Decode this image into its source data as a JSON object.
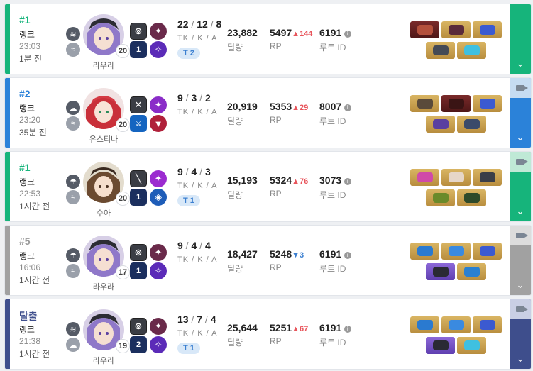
{
  "labels": {
    "kda": "TK / K / A",
    "damage": "딜량",
    "rp": "RP",
    "route": "루트 ID",
    "rank": "랭크"
  },
  "colors": {
    "win": "#16b47b",
    "second": "#2b82d9",
    "grey": "#a1a1a1",
    "escape": "#3e4e8c",
    "rp_up": "#e8555c",
    "rp_down": "#3b7fd0"
  },
  "games": [
    {
      "rank": "#1",
      "rank_label": "랭크",
      "time": "23:03",
      "ago": "1분 전",
      "character": "라우라",
      "level": "20",
      "tk": "22",
      "k": "12",
      "a": "8",
      "team": "T 2",
      "damage": "23,882",
      "rp": "5497",
      "rp_change": "▲144",
      "rp_dir": "up",
      "route": "6191",
      "weather": [
        "wind-icon",
        "fog-icon"
      ],
      "has_video": false
    },
    {
      "rank": "#2",
      "rank_label": "랭크",
      "time": "23:20",
      "ago": "35분 전",
      "character": "유스티나",
      "level": "20",
      "tk": "9",
      "k": "3",
      "a": "2",
      "team": "",
      "damage": "20,919",
      "rp": "5353",
      "rp_change": "▲29",
      "rp_dir": "up",
      "route": "8007",
      "weather": [
        "cloud-icon",
        "fog-icon"
      ],
      "has_video": true
    },
    {
      "rank": "#1",
      "rank_label": "랭크",
      "time": "22:53",
      "ago": "1시간 전",
      "character": "수아",
      "level": "20",
      "tk": "9",
      "k": "4",
      "a": "3",
      "team": "T 1",
      "damage": "15,193",
      "rp": "5324",
      "rp_change": "▲76",
      "rp_dir": "up",
      "route": "3073",
      "weather": [
        "rain-icon",
        "fog-icon"
      ],
      "has_video": true
    },
    {
      "rank": "#5",
      "rank_label": "랭크",
      "time": "16:06",
      "ago": "1시간 전",
      "character": "라우라",
      "level": "17",
      "tk": "9",
      "k": "4",
      "a": "4",
      "team": "",
      "damage": "18,427",
      "rp": "5248",
      "rp_change": "▼3",
      "rp_dir": "down",
      "route": "6191",
      "weather": [
        "rain-icon",
        "fog-icon"
      ],
      "has_video": true
    },
    {
      "rank": "탈출",
      "rank_label": "랭크",
      "time": "21:38",
      "ago": "1시간 전",
      "character": "라우라",
      "level": "19",
      "tk": "13",
      "k": "7",
      "a": "4",
      "team": "T 1",
      "damage": "25,644",
      "rp": "5251",
      "rp_change": "▲67",
      "rp_dir": "up",
      "route": "6191",
      "weather": [
        "wind-icon",
        "cloud-upload-icon"
      ],
      "has_video": true
    }
  ]
}
